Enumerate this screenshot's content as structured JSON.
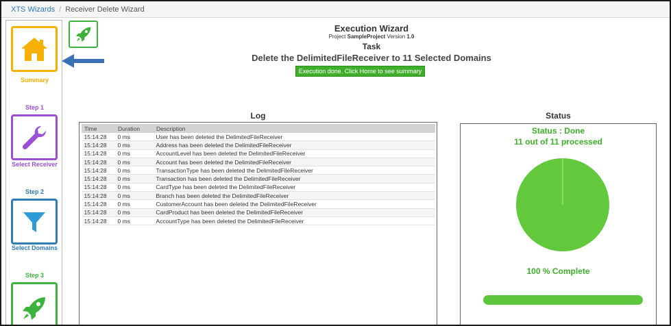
{
  "breadcrumb": {
    "root": "XTS Wizards",
    "current": "Receiver Delete Wizard"
  },
  "colors": {
    "summary": "#f6b000",
    "step1": "#9b4fd6",
    "step2": "#2e7db5",
    "step3": "#3db23d",
    "success": "#3fae2a",
    "arrow": "#3b6fb6"
  },
  "sidebar": {
    "summary": {
      "caption": "Summary",
      "icon": "home-icon"
    },
    "step1": {
      "label": "Step 1",
      "caption": "Select Receiver",
      "icon": "wrench-icon"
    },
    "step2": {
      "label": "Step 2",
      "caption": "Select Domains",
      "icon": "filter-icon"
    },
    "step3": {
      "label": "Step 3",
      "icon": "rocket-icon"
    }
  },
  "header": {
    "title": "Execution Wizard",
    "project_prefix": "Project",
    "project_name": "SampleProject",
    "version_prefix": "Version",
    "version": "1.0",
    "task_label": "Task",
    "task_description": "Delete the DelimitedFileReceiver to 11 Selected Domains",
    "execution_button": "Execution done. Click Home to see summary"
  },
  "log": {
    "title": "Log",
    "columns": [
      "Time",
      "Duration",
      "Description"
    ],
    "rows": [
      [
        "15:14:28",
        "0 ms",
        "User has been deleted the DelimitedFileReceiver"
      ],
      [
        "15:14:28",
        "0 ms",
        "Address has been deleted the DelimitedFileReceiver"
      ],
      [
        "15:14:28",
        "0 ms",
        "AccountLevel has been deleted the DelimitedFileReceiver"
      ],
      [
        "15:14:28",
        "0 ms",
        "Account has been deleted the DelimitedFileReceiver"
      ],
      [
        "15:14:28",
        "0 ms",
        "TransactionType has been deleted the DelimitedFileReceiver"
      ],
      [
        "15:14:28",
        "0 ms",
        "Transaction has been deleted the DelimitedFileReceiver"
      ],
      [
        "15:14:28",
        "0 ms",
        "CardType has been deleted the DelimitedFileReceiver"
      ],
      [
        "15:14:28",
        "0 ms",
        "Branch has been deleted the DelimitedFileReceiver"
      ],
      [
        "15:14:28",
        "0 ms",
        "CustomerAccount has been deleted the DelimitedFileReceiver"
      ],
      [
        "15:14:28",
        "0 ms",
        "CardProduct has been deleted the DelimitedFileReceiver"
      ],
      [
        "15:14:28",
        "0 ms",
        "AccountType has been deleted the DelimitedFileReceiver"
      ]
    ]
  },
  "status": {
    "title": "Status",
    "status_text": "Status : Done",
    "processed_text": "11 out of 11 processed",
    "complete_text": "100 % Complete",
    "progress_percent": 100,
    "pie_color": "#63c93c"
  }
}
